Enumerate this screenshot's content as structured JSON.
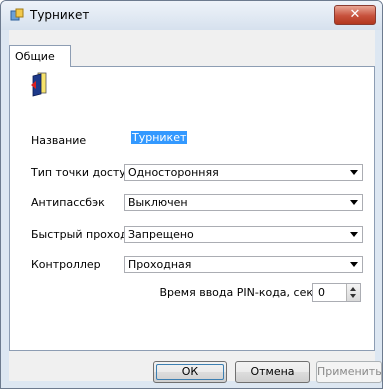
{
  "window": {
    "title": "Турникет",
    "close_label": "✕"
  },
  "tabs": [
    {
      "label": "Общие"
    }
  ],
  "form": {
    "name_label": "Название",
    "name_value": "Турникет",
    "access_type_label": "Тип точки доступа",
    "access_type_value": "Односторонняя",
    "antipassback_label": "Антипассбэк",
    "antipassback_value": "Выключен",
    "quick_pass_label": "Быстрый проход",
    "quick_pass_value": "Запрещено",
    "controller_label": "Контроллер",
    "controller_value": "Проходная",
    "pin_time_label": "Время ввода PIN-кода, сек",
    "pin_time_value": "0"
  },
  "buttons": {
    "ok": "ОК",
    "cancel": "Отмена",
    "apply": "Применить"
  },
  "icons": {
    "app": "turnstile-app-icon",
    "door": "door-icon"
  }
}
